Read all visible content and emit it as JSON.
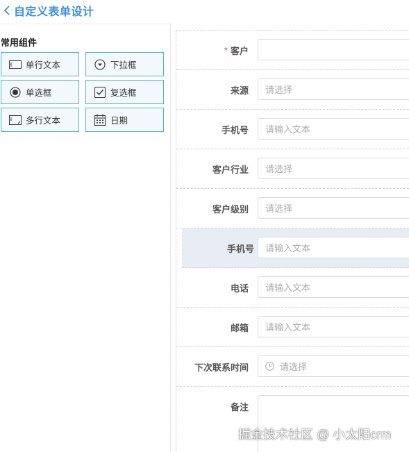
{
  "header": {
    "title": "自定义表单设计",
    "back_icon": "chevron-left-icon",
    "accent": "#3d8fe0"
  },
  "components": {
    "group_title": "常用组件",
    "items": [
      {
        "label": "单行文本",
        "icon": "single-line-text-icon"
      },
      {
        "label": "下拉框",
        "icon": "dropdown-icon"
      },
      {
        "label": "单选框",
        "icon": "radio-icon"
      },
      {
        "label": "复选框",
        "icon": "checkbox-icon"
      },
      {
        "label": "多行文本",
        "icon": "multi-line-text-icon"
      },
      {
        "label": "日期",
        "icon": "calendar-icon"
      }
    ]
  },
  "form": {
    "fields": [
      {
        "label": "客户",
        "required": "*",
        "placeholder": ""
      },
      {
        "label": "来源",
        "placeholder": "请选择"
      },
      {
        "label": "手机号",
        "placeholder": "请输入文本"
      },
      {
        "label": "客户行业",
        "placeholder": "请选择"
      },
      {
        "label": "客户级别",
        "placeholder": "请选择"
      },
      {
        "label": "手机号",
        "placeholder": "请输入文本",
        "state": "selected"
      },
      {
        "label": "电话",
        "placeholder": "请输入文本"
      },
      {
        "label": "邮箱",
        "placeholder": "请输入文本"
      },
      {
        "label": "下次联系时间",
        "placeholder": "请选择",
        "icon": "clock-icon"
      },
      {
        "label": "备注",
        "placeholder": ""
      }
    ]
  },
  "watermark": "掘金技术社区 @ 小太阳crm"
}
